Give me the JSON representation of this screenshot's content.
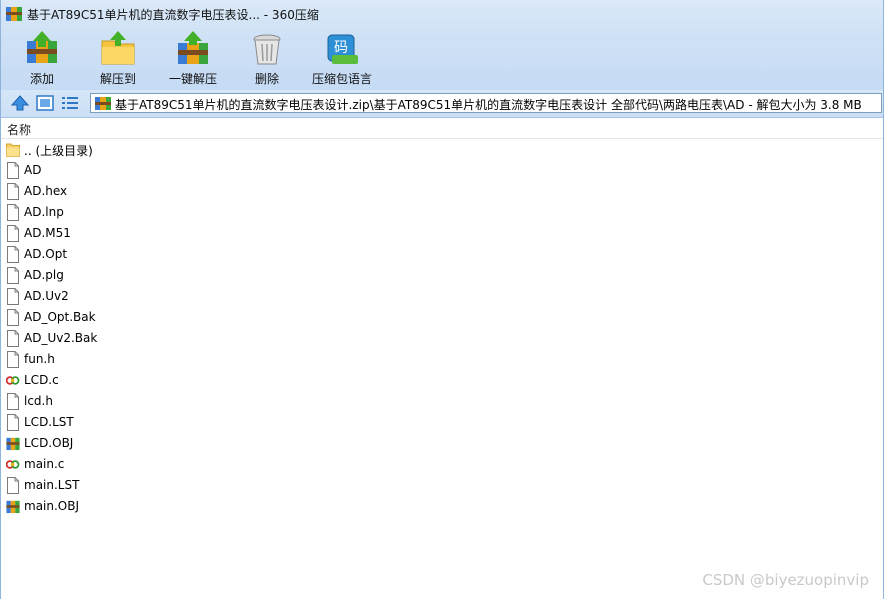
{
  "window": {
    "title": "基于AT89C51单片机的直流数字电压表设... - 360压缩"
  },
  "toolbar": {
    "items": [
      {
        "label": "添加",
        "icon": "add-archive-icon"
      },
      {
        "label": "解压到",
        "icon": "extract-to-icon"
      },
      {
        "label": "一键解压",
        "icon": "one-click-extract-icon"
      },
      {
        "label": "删除",
        "icon": "delete-icon"
      },
      {
        "label": "压缩包语言",
        "icon": "archive-language-icon"
      }
    ]
  },
  "addressbar": {
    "path": "基于AT89C51单片机的直流数字电压表设计.zip\\基于AT89C51单片机的直流数字电压表设计 全部代码\\两路电压表\\AD - 解包大小为 3.8 MB"
  },
  "filelist": {
    "column_name": "名称",
    "rows": [
      {
        "name": ".. (上级目录)",
        "icon": "folder-up-icon"
      },
      {
        "name": "AD",
        "icon": "file-icon"
      },
      {
        "name": "AD.hex",
        "icon": "file-icon"
      },
      {
        "name": "AD.lnp",
        "icon": "file-icon"
      },
      {
        "name": "AD.M51",
        "icon": "file-icon"
      },
      {
        "name": "AD.Opt",
        "icon": "file-icon"
      },
      {
        "name": "AD.plg",
        "icon": "file-icon"
      },
      {
        "name": "AD.Uv2",
        "icon": "file-icon"
      },
      {
        "name": "AD_Opt.Bak",
        "icon": "file-icon"
      },
      {
        "name": "AD_Uv2.Bak",
        "icon": "file-icon"
      },
      {
        "name": "fun.h",
        "icon": "file-icon"
      },
      {
        "name": "LCD.c",
        "icon": "c-source-icon"
      },
      {
        "name": "lcd.h",
        "icon": "file-icon"
      },
      {
        "name": "LCD.LST",
        "icon": "file-icon"
      },
      {
        "name": "LCD.OBJ",
        "icon": "archive-file-icon"
      },
      {
        "name": "main.c",
        "icon": "c-source-icon"
      },
      {
        "name": "main.LST",
        "icon": "file-icon"
      },
      {
        "name": "main.OBJ",
        "icon": "archive-file-icon"
      }
    ]
  },
  "watermark": "CSDN @biyezuopinvip"
}
